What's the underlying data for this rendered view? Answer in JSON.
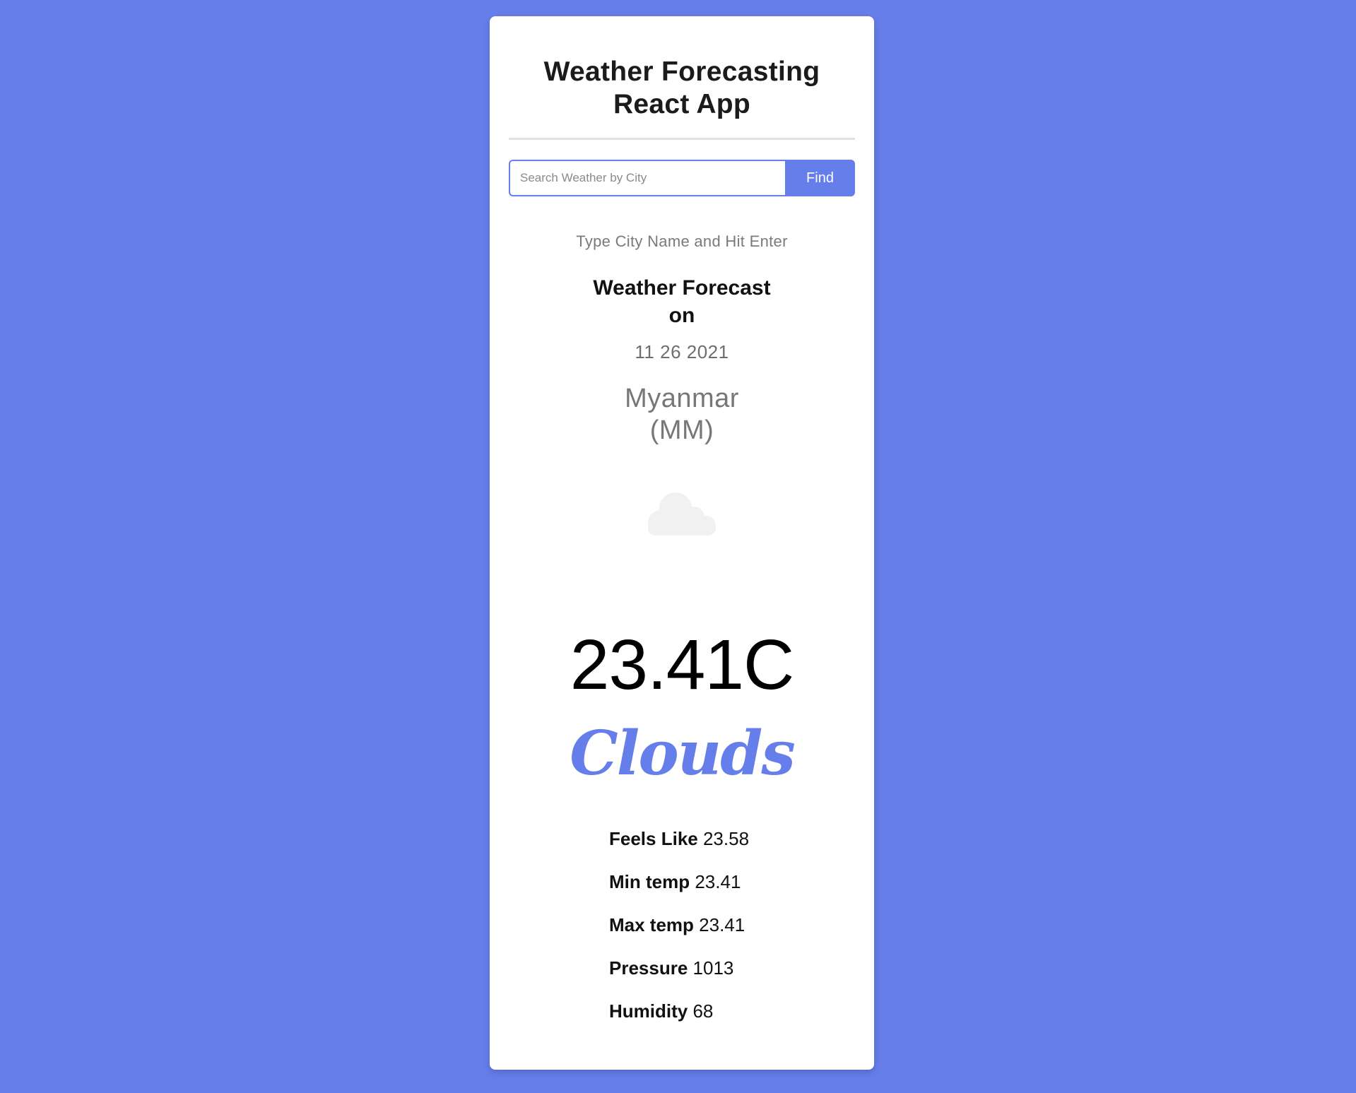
{
  "app": {
    "title_line1": "Weather Forecasting",
    "title_line2": "React App"
  },
  "search": {
    "placeholder": "Search Weather by City",
    "value": "",
    "button_label": "Find",
    "hint": "Type City Name and Hit Enter"
  },
  "forecast": {
    "heading_line1": "Weather Forecast",
    "heading_line2": "on",
    "date": "11 26 2021",
    "location_line1": "Myanmar",
    "location_line2": "(MM)",
    "icon": "cloud-icon",
    "temperature": "23.41C",
    "condition": "Clouds"
  },
  "details": [
    {
      "label": "Feels Like",
      "value": "23.58"
    },
    {
      "label": "Min temp",
      "value": "23.41"
    },
    {
      "label": "Max temp",
      "value": "23.41"
    },
    {
      "label": "Pressure",
      "value": "1013"
    },
    {
      "label": "Humidity",
      "value": "68"
    }
  ],
  "colors": {
    "background": "#667eea",
    "accent": "#667eea",
    "card": "#ffffff"
  }
}
